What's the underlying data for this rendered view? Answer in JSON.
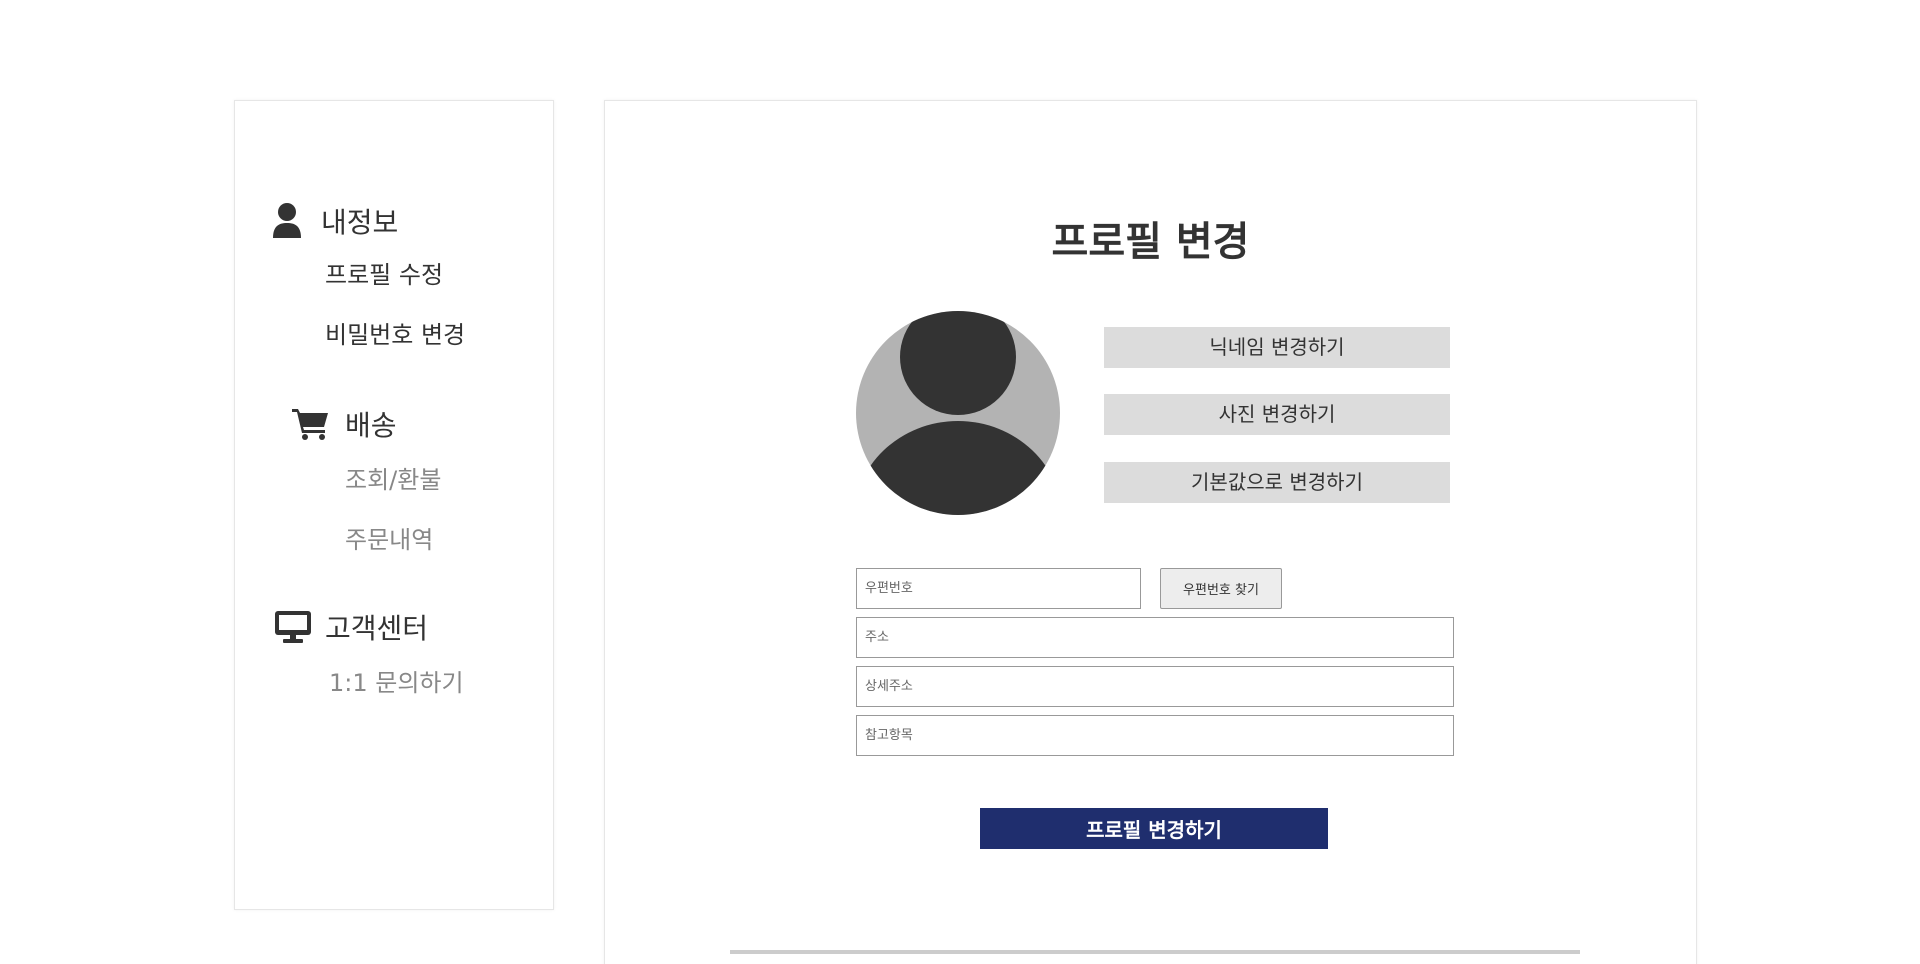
{
  "sidebar": {
    "my_info": {
      "icon": "user-icon",
      "title": "내정보",
      "items": [
        "프로필 수정",
        "비밀번호 변경"
      ]
    },
    "shipping": {
      "icon": "shopping-cart-icon",
      "title": "배송",
      "items": [
        "조회/환불",
        "주문내역"
      ]
    },
    "support": {
      "icon": "monitor-icon",
      "title": "고객센터",
      "items": [
        "1:1 문의하기"
      ]
    }
  },
  "main": {
    "title": "프로필 변경",
    "avatar_icon": "default-avatar-icon",
    "buttons": {
      "nickname": "닉네임 변경하기",
      "photo": "사진 변경하기",
      "reset": "기본값으로 변경하기"
    },
    "address": {
      "zipcode": {
        "value": "",
        "placeholder": "우편번호"
      },
      "find_zip_label": "우편번호 찾기",
      "address": {
        "value": "",
        "placeholder": "주소"
      },
      "detail": {
        "value": "",
        "placeholder": "상세주소"
      },
      "extra": {
        "value": "",
        "placeholder": "참고항목"
      }
    },
    "submit_label": "프로필 변경하기"
  },
  "colors": {
    "accent": "#1f2e6e",
    "button_gray": "#dcdcdc",
    "icon_dark": "#333333",
    "avatar_bg": "#b3b3b3",
    "muted_text": "#888888"
  }
}
